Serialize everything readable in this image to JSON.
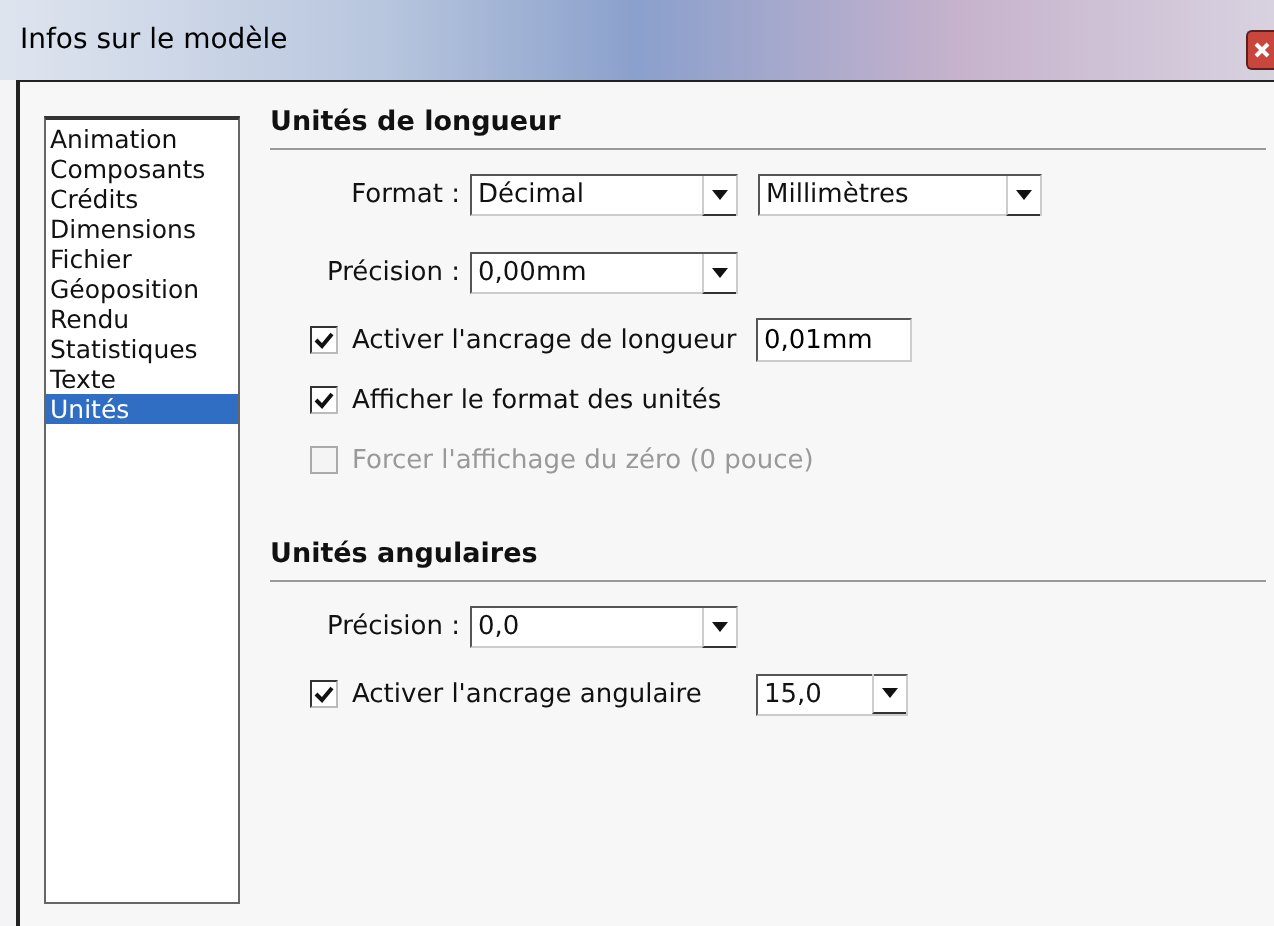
{
  "window": {
    "title": "Infos sur le modèle"
  },
  "sidebar": {
    "items": [
      {
        "label": "Animation",
        "selected": false
      },
      {
        "label": "Composants",
        "selected": false
      },
      {
        "label": "Crédits",
        "selected": false
      },
      {
        "label": "Dimensions",
        "selected": false
      },
      {
        "label": "Fichier",
        "selected": false
      },
      {
        "label": "Géoposition",
        "selected": false
      },
      {
        "label": "Rendu",
        "selected": false
      },
      {
        "label": "Statistiques",
        "selected": false
      },
      {
        "label": "Texte",
        "selected": false
      },
      {
        "label": "Unités",
        "selected": true
      }
    ]
  },
  "sections": [
    {
      "title": "Unités de longueur",
      "rows": [
        {
          "kind": "fields",
          "label": "Format :",
          "controls": [
            {
              "kind": "select",
              "value": "Décimal"
            },
            {
              "kind": "select",
              "value": "Millimètres"
            }
          ]
        },
        {
          "kind": "fields",
          "label": "Précision :",
          "controls": [
            {
              "kind": "select",
              "value": "0,00mm"
            }
          ]
        },
        {
          "kind": "check",
          "label": "Activer l'ancrage de longueur",
          "checked": true,
          "disabled": false,
          "controls": [
            {
              "kind": "input",
              "value": "0,01mm"
            }
          ]
        },
        {
          "kind": "check",
          "label": "Afficher le format des unités",
          "checked": true,
          "disabled": false
        },
        {
          "kind": "check",
          "label": "Forcer l'affichage du zéro (0 pouce)",
          "checked": false,
          "disabled": true
        }
      ]
    },
    {
      "title": "Unités angulaires",
      "rows": [
        {
          "kind": "fields",
          "label": "Précision :",
          "controls": [
            {
              "kind": "select",
              "value": "0,0"
            }
          ]
        },
        {
          "kind": "check",
          "label": "Activer l'ancrage angulaire",
          "checked": true,
          "disabled": false,
          "controls": [
            {
              "kind": "smallselect",
              "value": "15,0"
            }
          ]
        }
      ]
    }
  ]
}
